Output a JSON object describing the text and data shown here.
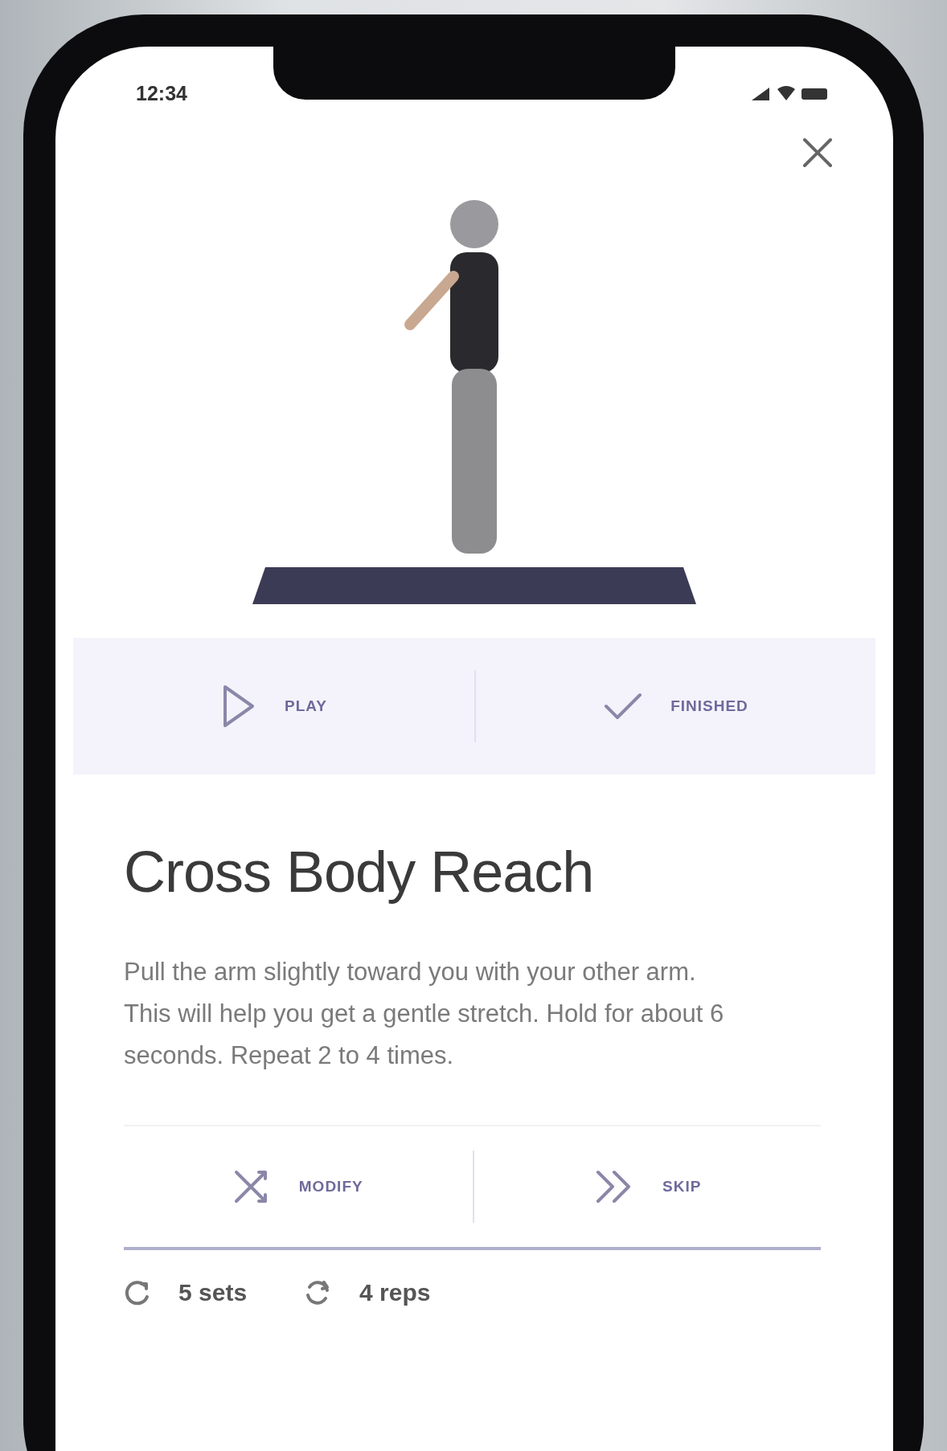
{
  "status_bar": {
    "time": "12:34"
  },
  "exercise": {
    "title": "Cross Body Reach",
    "description": "Pull the arm slightly toward you with your other arm. This will help you get a gentle stretch. Hold for about 6 seconds. Repeat 2 to 4 times."
  },
  "primary_actions": [
    {
      "kind": "play",
      "label": "PLAY"
    },
    {
      "kind": "check",
      "label": "FINISHED"
    }
  ],
  "secondary_actions": [
    {
      "kind": "shuffle",
      "label": "MODIFY"
    },
    {
      "kind": "skip",
      "label": "SKIP"
    }
  ],
  "stats": [
    {
      "kind": "sets",
      "label": "5 sets"
    },
    {
      "kind": "reps",
      "label": "4 reps"
    }
  ]
}
